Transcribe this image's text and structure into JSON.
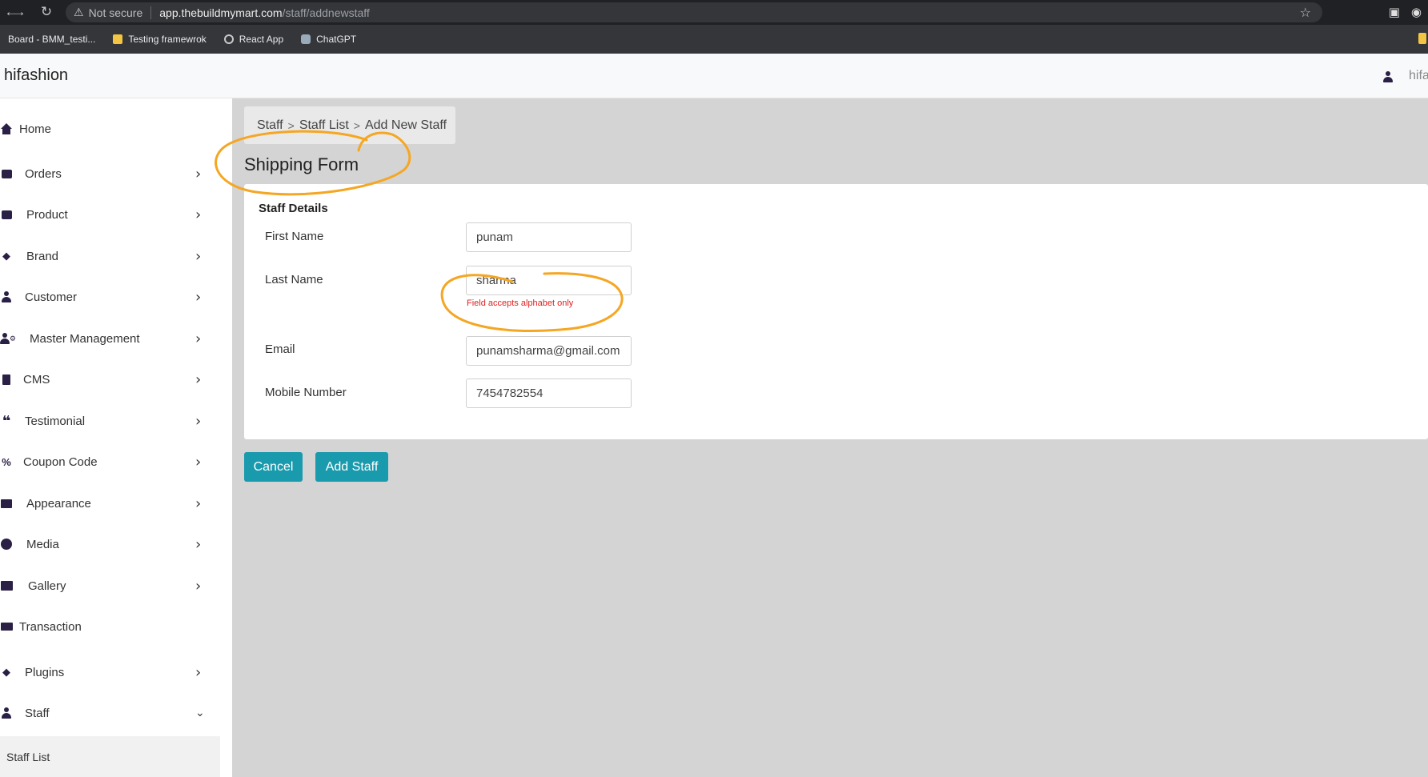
{
  "browser": {
    "security_label": "Not secure",
    "url_host": "app.thebuildmymart.com",
    "url_path": "/staff/addnewstaff",
    "bookmarks": [
      "Board - BMM_testi...",
      "Testing framewrok",
      "React App",
      "ChatGPT"
    ]
  },
  "header": {
    "brand": "hifashion",
    "user": "hifa"
  },
  "sidebar": {
    "items": [
      {
        "label": "Home",
        "icon": "home-icon"
      },
      {
        "label": "Orders",
        "icon": "shopping-bag-icon"
      },
      {
        "label": "Product",
        "icon": "archive-box-icon"
      },
      {
        "label": "Brand",
        "icon": "tags-icon"
      },
      {
        "label": "Customer",
        "icon": "user-icon"
      },
      {
        "label": "Master Management",
        "icon": "user-gear-icon"
      },
      {
        "label": "CMS",
        "icon": "file-icon"
      },
      {
        "label": "Testimonial",
        "icon": "quote-icon"
      },
      {
        "label": "Coupon Code",
        "icon": "percent-icon"
      },
      {
        "label": "Appearance",
        "icon": "image-icon"
      },
      {
        "label": "Media",
        "icon": "play-circle-icon"
      },
      {
        "label": "Gallery",
        "icon": "images-icon"
      },
      {
        "label": "Transaction",
        "icon": "money-check-icon"
      },
      {
        "label": "Plugins",
        "icon": "tag-icon"
      },
      {
        "label": "Staff",
        "icon": "user-icon"
      }
    ],
    "sub_item": "Staff List"
  },
  "breadcrumb": [
    "Staff",
    "Staff List",
    "Add New Staff"
  ],
  "breadcrumb_separator": ">",
  "page_title": "Shipping Form",
  "form": {
    "section_title": "Staff Details",
    "fields": [
      {
        "label": "First Name",
        "value": "punam"
      },
      {
        "label": "Last Name",
        "value": "sharma",
        "error": "Field accepts alphabet only"
      },
      {
        "label": "Email",
        "value": "punamsharma@gmail.com"
      },
      {
        "label": "Mobile Number",
        "value": "7454782554"
      }
    ]
  },
  "buttons": {
    "cancel": "Cancel",
    "add": "Add Staff"
  },
  "colors": {
    "accent": "#1a9aad",
    "error": "#e02020",
    "annotation": "#f5a623"
  }
}
